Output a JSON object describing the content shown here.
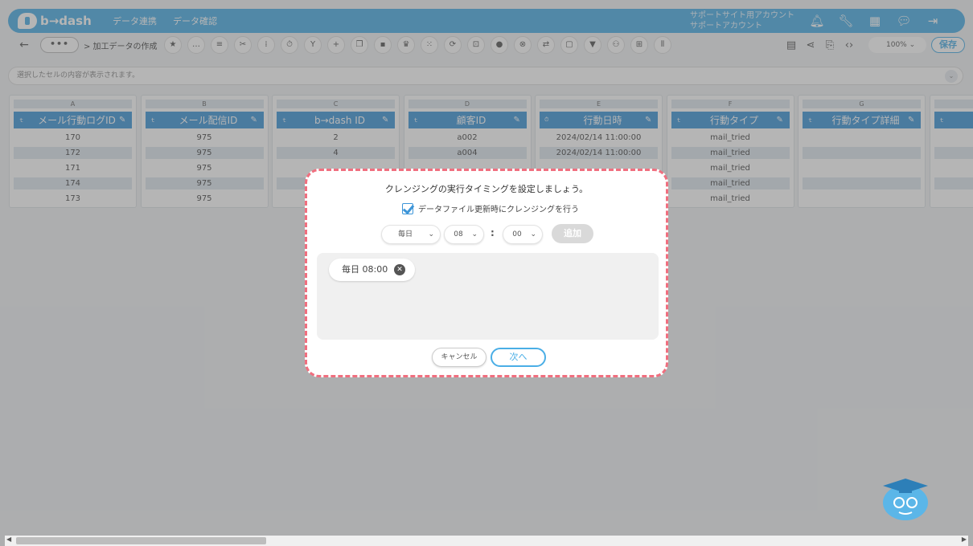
{
  "app": {
    "logo_text": "b→dash"
  },
  "header": {
    "nav": [
      "データ連携",
      "データ確認"
    ],
    "account_line1": "サポートサイト用アカウント",
    "account_line2": "サポートアカウント",
    "icons": [
      "bell-icon",
      "wrench-icon",
      "apps-grid-icon",
      "chat-icon",
      "logout-icon"
    ]
  },
  "toolbar": {
    "back": "←",
    "more": "•••",
    "breadcrumb": "> 加工データの作成",
    "zoom": "100%",
    "save_label": "保存"
  },
  "cellbar": {
    "placeholder": "選択したセルの内容が表示されます。"
  },
  "grid": {
    "columns": [
      {
        "letter": "A",
        "name": "メール行動ログID",
        "icon": "テキスト",
        "cells": [
          "170",
          "172",
          "171",
          "174",
          "173"
        ]
      },
      {
        "letter": "B",
        "name": "メール配信ID",
        "icon": "テキスト",
        "cells": [
          "975",
          "975",
          "975",
          "975",
          "975"
        ]
      },
      {
        "letter": "C",
        "name": "b→dash ID",
        "icon": "テキスト",
        "cells": [
          "2",
          "4",
          "",
          "",
          ""
        ]
      },
      {
        "letter": "D",
        "name": "顧客ID",
        "icon": "テキスト",
        "cells": [
          "a002",
          "a004",
          "",
          "",
          ""
        ]
      },
      {
        "letter": "E",
        "name": "行動日時",
        "icon": "日時",
        "cells": [
          "2024/02/14 11:00:00",
          "2024/02/14 11:00:00",
          "",
          "",
          ""
        ]
      },
      {
        "letter": "F",
        "name": "行動タイプ",
        "icon": "テキスト",
        "cells": [
          "mail_tried",
          "mail_tried",
          "mail_tried",
          "mail_tried",
          "mail_tried"
        ]
      },
      {
        "letter": "G",
        "name": "行動タイプ詳細",
        "icon": "テキスト",
        "cells": [
          "",
          "",
          "",
          "",
          ""
        ]
      },
      {
        "letter": "",
        "name": "",
        "icon": "テキスト",
        "cells": [
          "",
          "",
          "",
          "",
          ""
        ]
      }
    ]
  },
  "modal": {
    "title": "クレンジングの実行タイミングを設定しましょう。",
    "checkbox_label": "データファイル更新時にクレンジングを行う",
    "frequency": "毎日",
    "hour": "08",
    "minute": "00",
    "colon": ":",
    "add_label": "追加",
    "schedule": [
      "毎日 08:00"
    ],
    "cancel_label": "キャンセル",
    "next_label": "次へ"
  },
  "colors": {
    "accent": "#4aaee6",
    "header_blue": "#3d95d8",
    "highlight": "#f06f7f"
  }
}
